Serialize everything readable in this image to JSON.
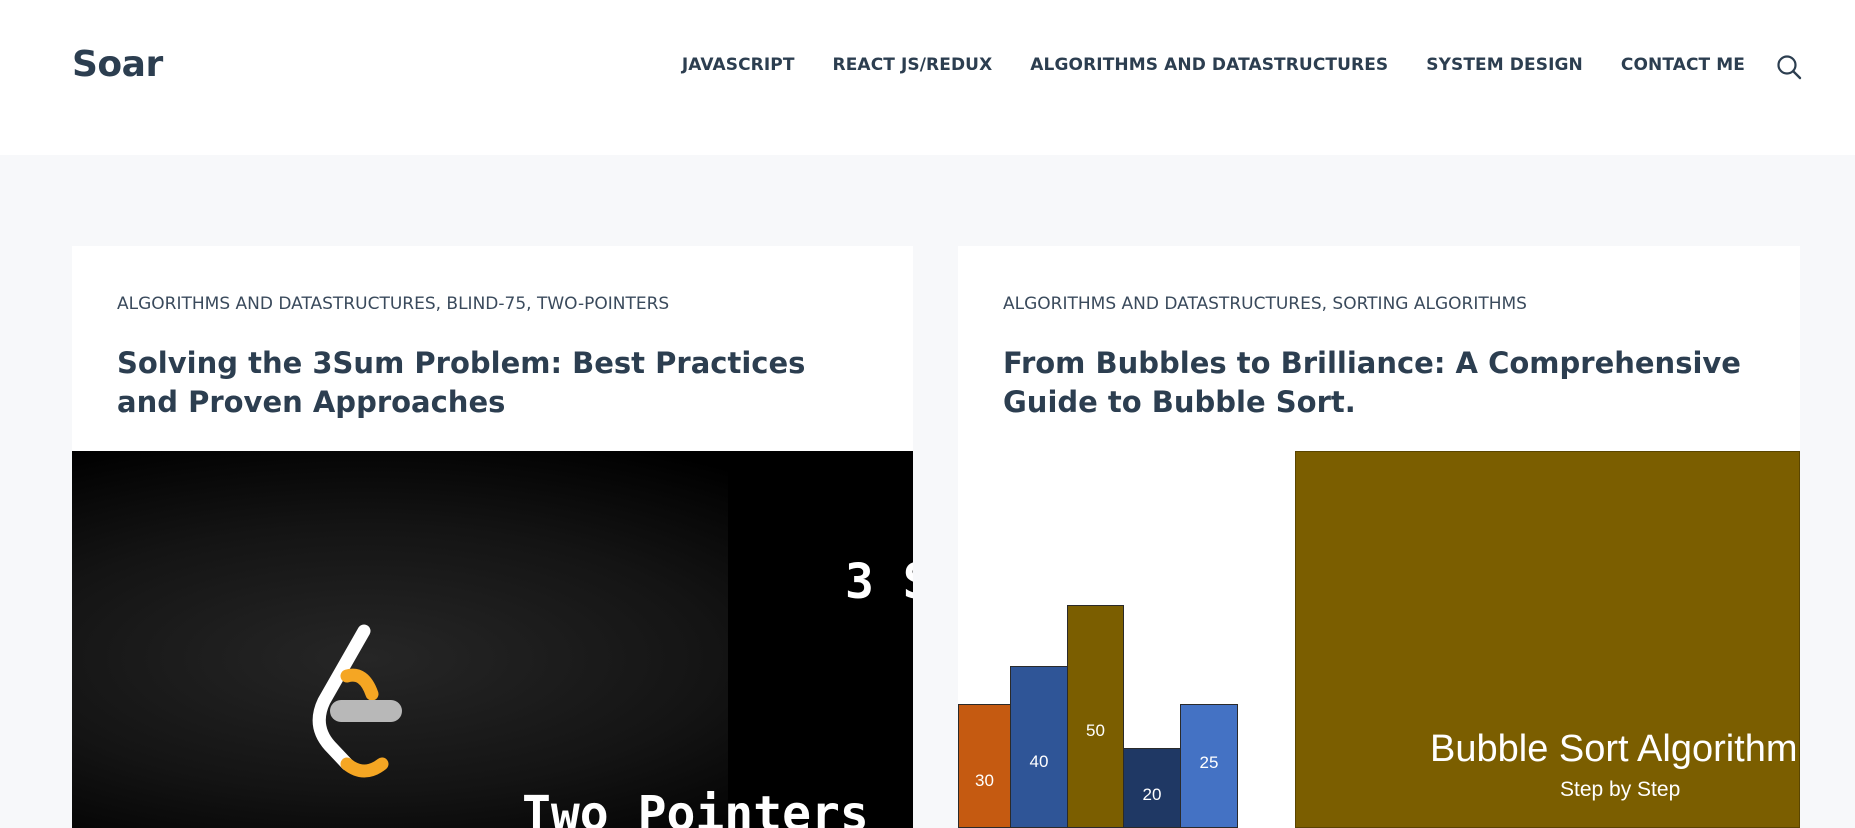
{
  "header": {
    "logo": "Soar",
    "nav": [
      "JAVASCRIPT",
      "REACT JS/REDUX",
      "ALGORITHMS AND DATASTRUCTURES",
      "SYSTEM DESIGN",
      "CONTACT ME"
    ],
    "search_icon": "search-icon"
  },
  "posts": [
    {
      "categories": "ALGORITHMS AND DATASTRUCTURES, BLIND-75, TWO-POINTERS",
      "title": "Solving the 3Sum Problem: Best Practices and Proven Approaches",
      "thumbnail": {
        "text_top": "3 S",
        "text_bottom": "Two Pointers",
        "logo": "leetcode-logo-icon"
      }
    },
    {
      "categories": "ALGORITHMS AND DATASTRUCTURES, SORTING ALGORITHMS",
      "title": "From Bubbles to Brilliance: A Comprehensive Guide to Bubble Sort.",
      "thumbnail": {
        "bars": [
          {
            "label": "30",
            "color": "#c55a11"
          },
          {
            "label": "40",
            "color": "#2f5597"
          },
          {
            "label": "50",
            "color": "#7b5e00"
          },
          {
            "label": "20",
            "color": "#1f3864"
          },
          {
            "label": "25",
            "color": "#4472c4"
          }
        ],
        "panel_title": "Bubble Sort Algorithm",
        "panel_subtitle": "Step by Step",
        "panel_color": "#7b5e00"
      }
    }
  ]
}
